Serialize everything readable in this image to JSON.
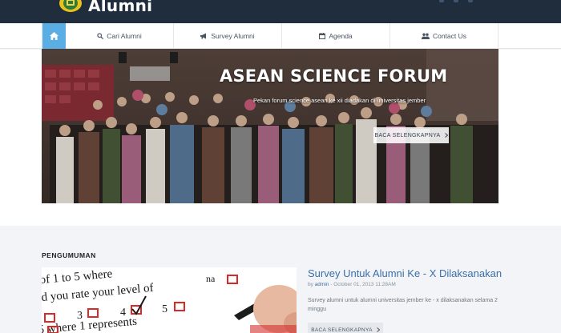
{
  "header": {
    "site_name": "Alumni",
    "logo_icon": "university-seal-icon"
  },
  "nav": {
    "home_icon": "home-icon",
    "items": [
      {
        "label": "Cari Alumni",
        "icon": "search-icon"
      },
      {
        "label": "Survey Alumni",
        "icon": "bullhorn-icon"
      },
      {
        "label": "Agenda",
        "icon": "calendar-icon"
      },
      {
        "label": "Contact Us",
        "icon": "users-icon"
      }
    ]
  },
  "slider": {
    "title": "ASEAN SCIENCE FORUM",
    "caption": "Pekan forum science asean ke xii diadakan di universitas jember",
    "button_label": "BACA SELENGKAPNYA"
  },
  "announcements": {
    "section_title": "PENGUMUMAN",
    "post": {
      "title": "Survey Untuk Alumni Ke - X Dilaksanakan",
      "meta_by": "by",
      "author": "admin",
      "date": "- October 01, 2013 11:28AM",
      "description": "Survey alumni untuk alumni universitas jember ke - x dilaksanakan selama 2 minggu",
      "button_label": "BACA SELENGKAPNYA"
    }
  },
  "colors": {
    "header_bg": "#1f2d3d",
    "nav_active": "#5aaee4",
    "link": "#3c6fa8"
  }
}
